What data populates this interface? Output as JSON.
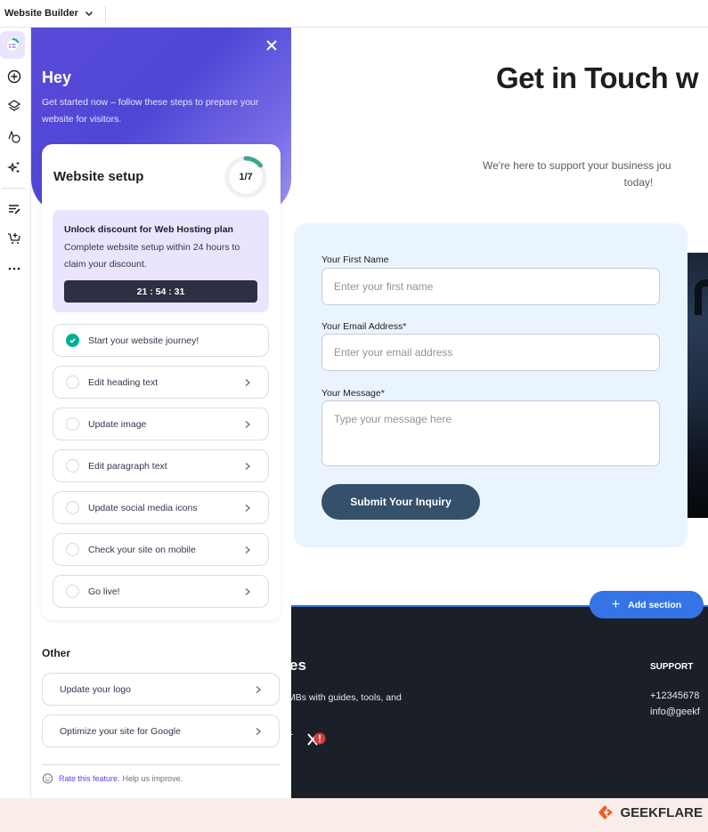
{
  "topbar": {
    "title": "Website Builder"
  },
  "rail": {
    "items": [
      {
        "name": "setup-progress"
      },
      {
        "name": "add-element"
      },
      {
        "name": "layers"
      },
      {
        "name": "styles"
      },
      {
        "name": "ai-tools"
      },
      {
        "name": "blog"
      },
      {
        "name": "store"
      },
      {
        "name": "more"
      }
    ]
  },
  "panel": {
    "greeting": "Hey",
    "subtitle": "Get started now – follow these steps to prepare your website for visitors.",
    "setup": {
      "title": "Website setup",
      "progress_label": "1/7",
      "progress_completed": 1,
      "progress_total": 7
    },
    "promo": {
      "heading": "Unlock discount for Web Hosting plan",
      "body": "Complete website setup within 24 hours to claim your discount.",
      "timer": "21 : 54 : 31"
    },
    "steps": [
      {
        "label": "Start your website journey!",
        "done": true
      },
      {
        "label": "Edit heading text",
        "done": false
      },
      {
        "label": "Update image",
        "done": false
      },
      {
        "label": "Edit paragraph text",
        "done": false
      },
      {
        "label": "Update social media icons",
        "done": false
      },
      {
        "label": "Check your site on mobile",
        "done": false
      },
      {
        "label": "Go live!",
        "done": false
      }
    ],
    "other": {
      "heading": "Other",
      "items": [
        {
          "label": "Update your logo"
        },
        {
          "label": "Optimize your site for Google"
        }
      ]
    },
    "feedback": {
      "link": "Rate this feature.",
      "text": "Help us improve."
    }
  },
  "canvas": {
    "heading": "Get in Touch w",
    "lead_line1": "We're here to support your business jou",
    "lead_line2": "today!",
    "form": {
      "first_name_label": "Your First Name",
      "first_name_placeholder": "Enter your first name",
      "email_label": "Your Email Address*",
      "email_placeholder": "Enter your email address",
      "message_label": "Your Message*",
      "message_placeholder": "Type your message here",
      "submit_label": "Submit Your Inquiry"
    },
    "add_section_label": "Add section",
    "footer": {
      "heading_fragment": "es",
      "description_fragment": "MBs with guides, tools, and",
      "support_heading": "SUPPORT",
      "phone": "+12345678",
      "email": "info@geekf"
    }
  },
  "brand": {
    "name": "GEEKFLARE"
  },
  "colors": {
    "accent": "#673de6",
    "hero": "#4f46d6",
    "success": "#00b090",
    "submit": "#34506b",
    "add_section": "#3474e6",
    "footer_bg": "#1b1f27",
    "brand_orange": "#f05a22"
  }
}
